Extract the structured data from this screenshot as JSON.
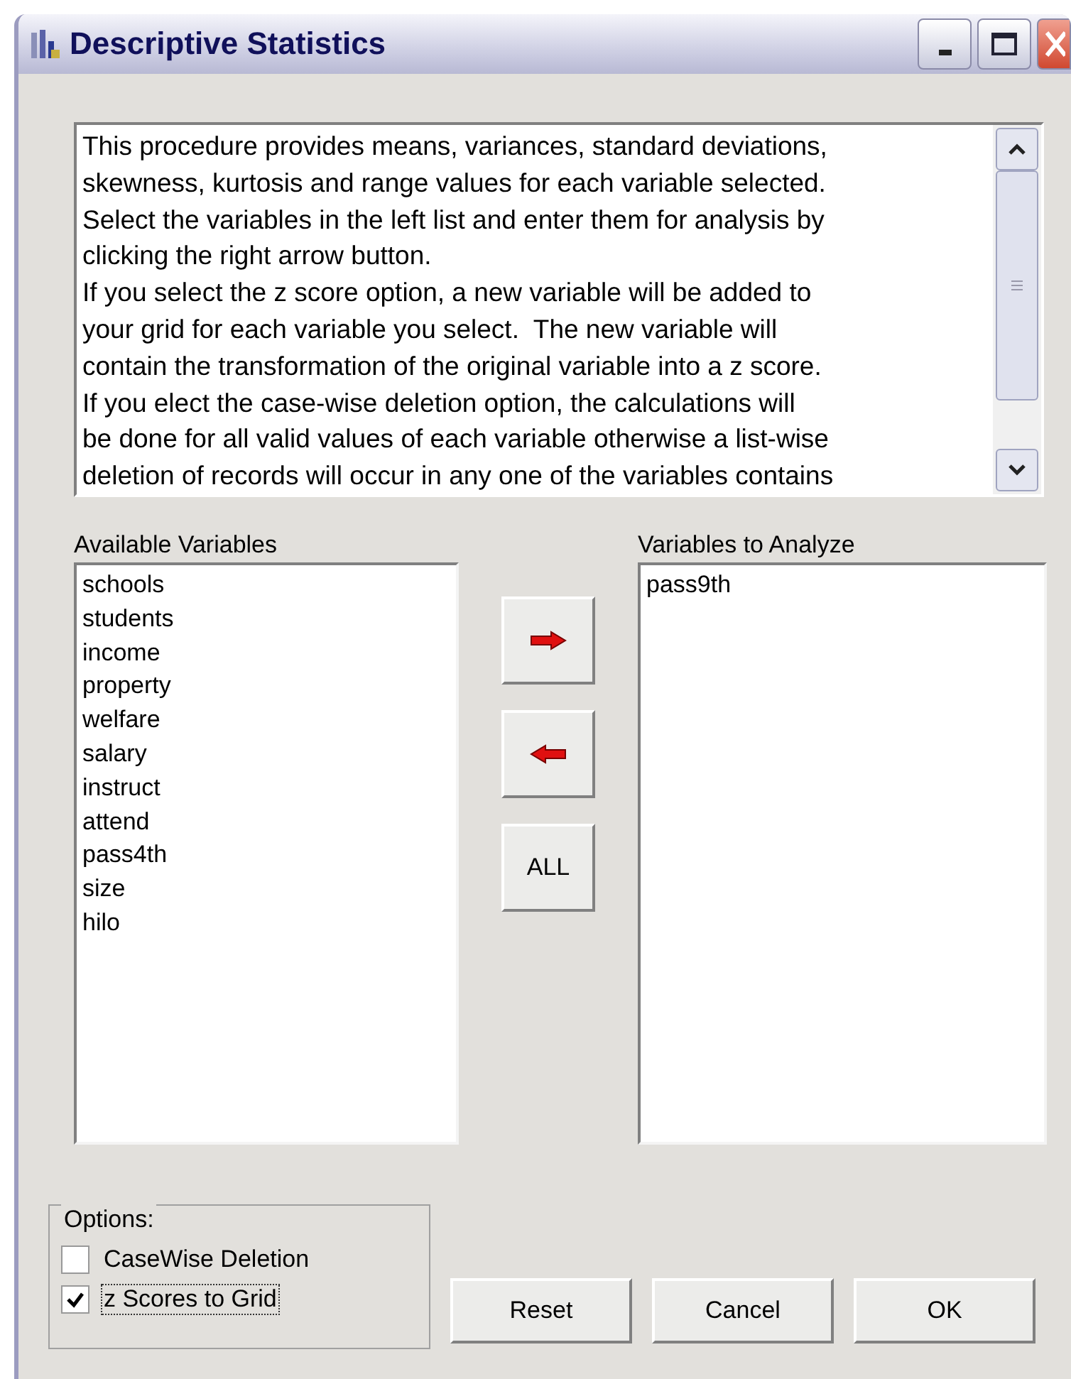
{
  "window": {
    "title": "Descriptive Statistics"
  },
  "description": {
    "lines": [
      "This procedure provides means, variances, standard deviations,",
      "skewness, kurtosis and range values for each variable selected.",
      "Select the variables in the left list and enter them for analysis by",
      "clicking the right arrow button.",
      "If you select the z score option, a new variable will be added to",
      "your grid for each variable you select.  The new variable will",
      "contain the transformation of the original variable into a z score.",
      "If you elect the case-wise deletion option, the calculations will",
      "be done for all valid values of each variable otherwise a list-wise",
      "deletion of records will occur in any one of the variables contains"
    ]
  },
  "available": {
    "label": "Available Variables",
    "items": [
      "schools",
      "students",
      "income",
      "property",
      "welfare",
      "salary",
      "instruct",
      "attend",
      "pass4th",
      "size",
      "hilo"
    ]
  },
  "move_buttons": [
    {
      "kind": "right"
    },
    {
      "kind": "left"
    },
    {
      "kind": "text",
      "label": "ALL"
    }
  ],
  "selected": {
    "label": "Variables to Analyze",
    "items": [
      "pass9th"
    ]
  },
  "options": {
    "title": "Options:",
    "items": [
      {
        "label": "CaseWise Deletion",
        "checked": false,
        "focused": false
      },
      {
        "label": "z Scores to Grid",
        "checked": true,
        "focused": true
      }
    ]
  },
  "buttons": [
    "Reset",
    "Cancel",
    "OK"
  ]
}
